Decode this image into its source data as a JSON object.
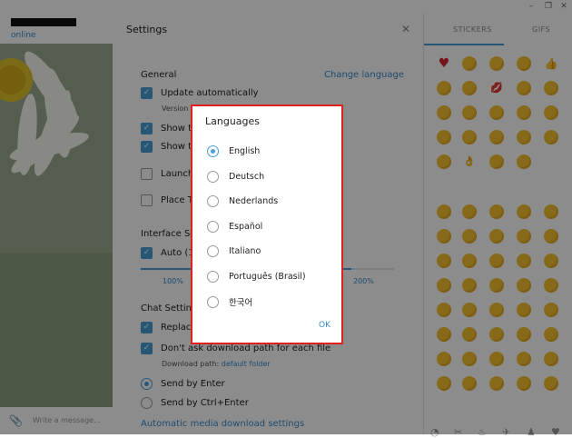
{
  "window": {
    "minimize": "–",
    "restore": "❐",
    "close": "✕"
  },
  "chat": {
    "status": "online",
    "input_placeholder": "Write a message..."
  },
  "settings": {
    "title": "Settings",
    "general": {
      "title": "General",
      "change_language": "Change language",
      "update_automatically": "Update automatically",
      "version": "Version",
      "show_tray": "Show tr",
      "show_taskbar": "Show ta",
      "launch": "Launch",
      "place": "Place T"
    },
    "interface_scale": {
      "title": "Interface Sc",
      "auto": "Auto (1",
      "tick_100": "100%",
      "tick_200": "200%",
      "value_fraction": 0.83
    },
    "chat_settings": {
      "title": "Chat Settin",
      "replace": "Replace",
      "dont_ask": "Don't ask download path for each file",
      "download_path_label": "Download path:",
      "download_path_value": "default folder",
      "send_enter": "Send by Enter",
      "send_ctrl_enter": "Send by Ctrl+Enter",
      "auto_media": "Automatic media download settings"
    }
  },
  "emoji_panel": {
    "tabs": {
      "stickers": "STICKERS",
      "gifs": "GIFS"
    },
    "icons": [
      "recent-icon",
      "food-icon",
      "activity-icon",
      "travel-icon",
      "objects-icon",
      "symbols-icon"
    ]
  },
  "dialog": {
    "title": "Languages",
    "selected": "English",
    "languages": [
      "English",
      "Deutsch",
      "Nederlands",
      "Español",
      "Italiano",
      "Português (Brasil)",
      "한국어"
    ],
    "ok": "OK"
  },
  "colors": {
    "accent": "#4a9fd8",
    "highlight_border": "#e02020"
  }
}
